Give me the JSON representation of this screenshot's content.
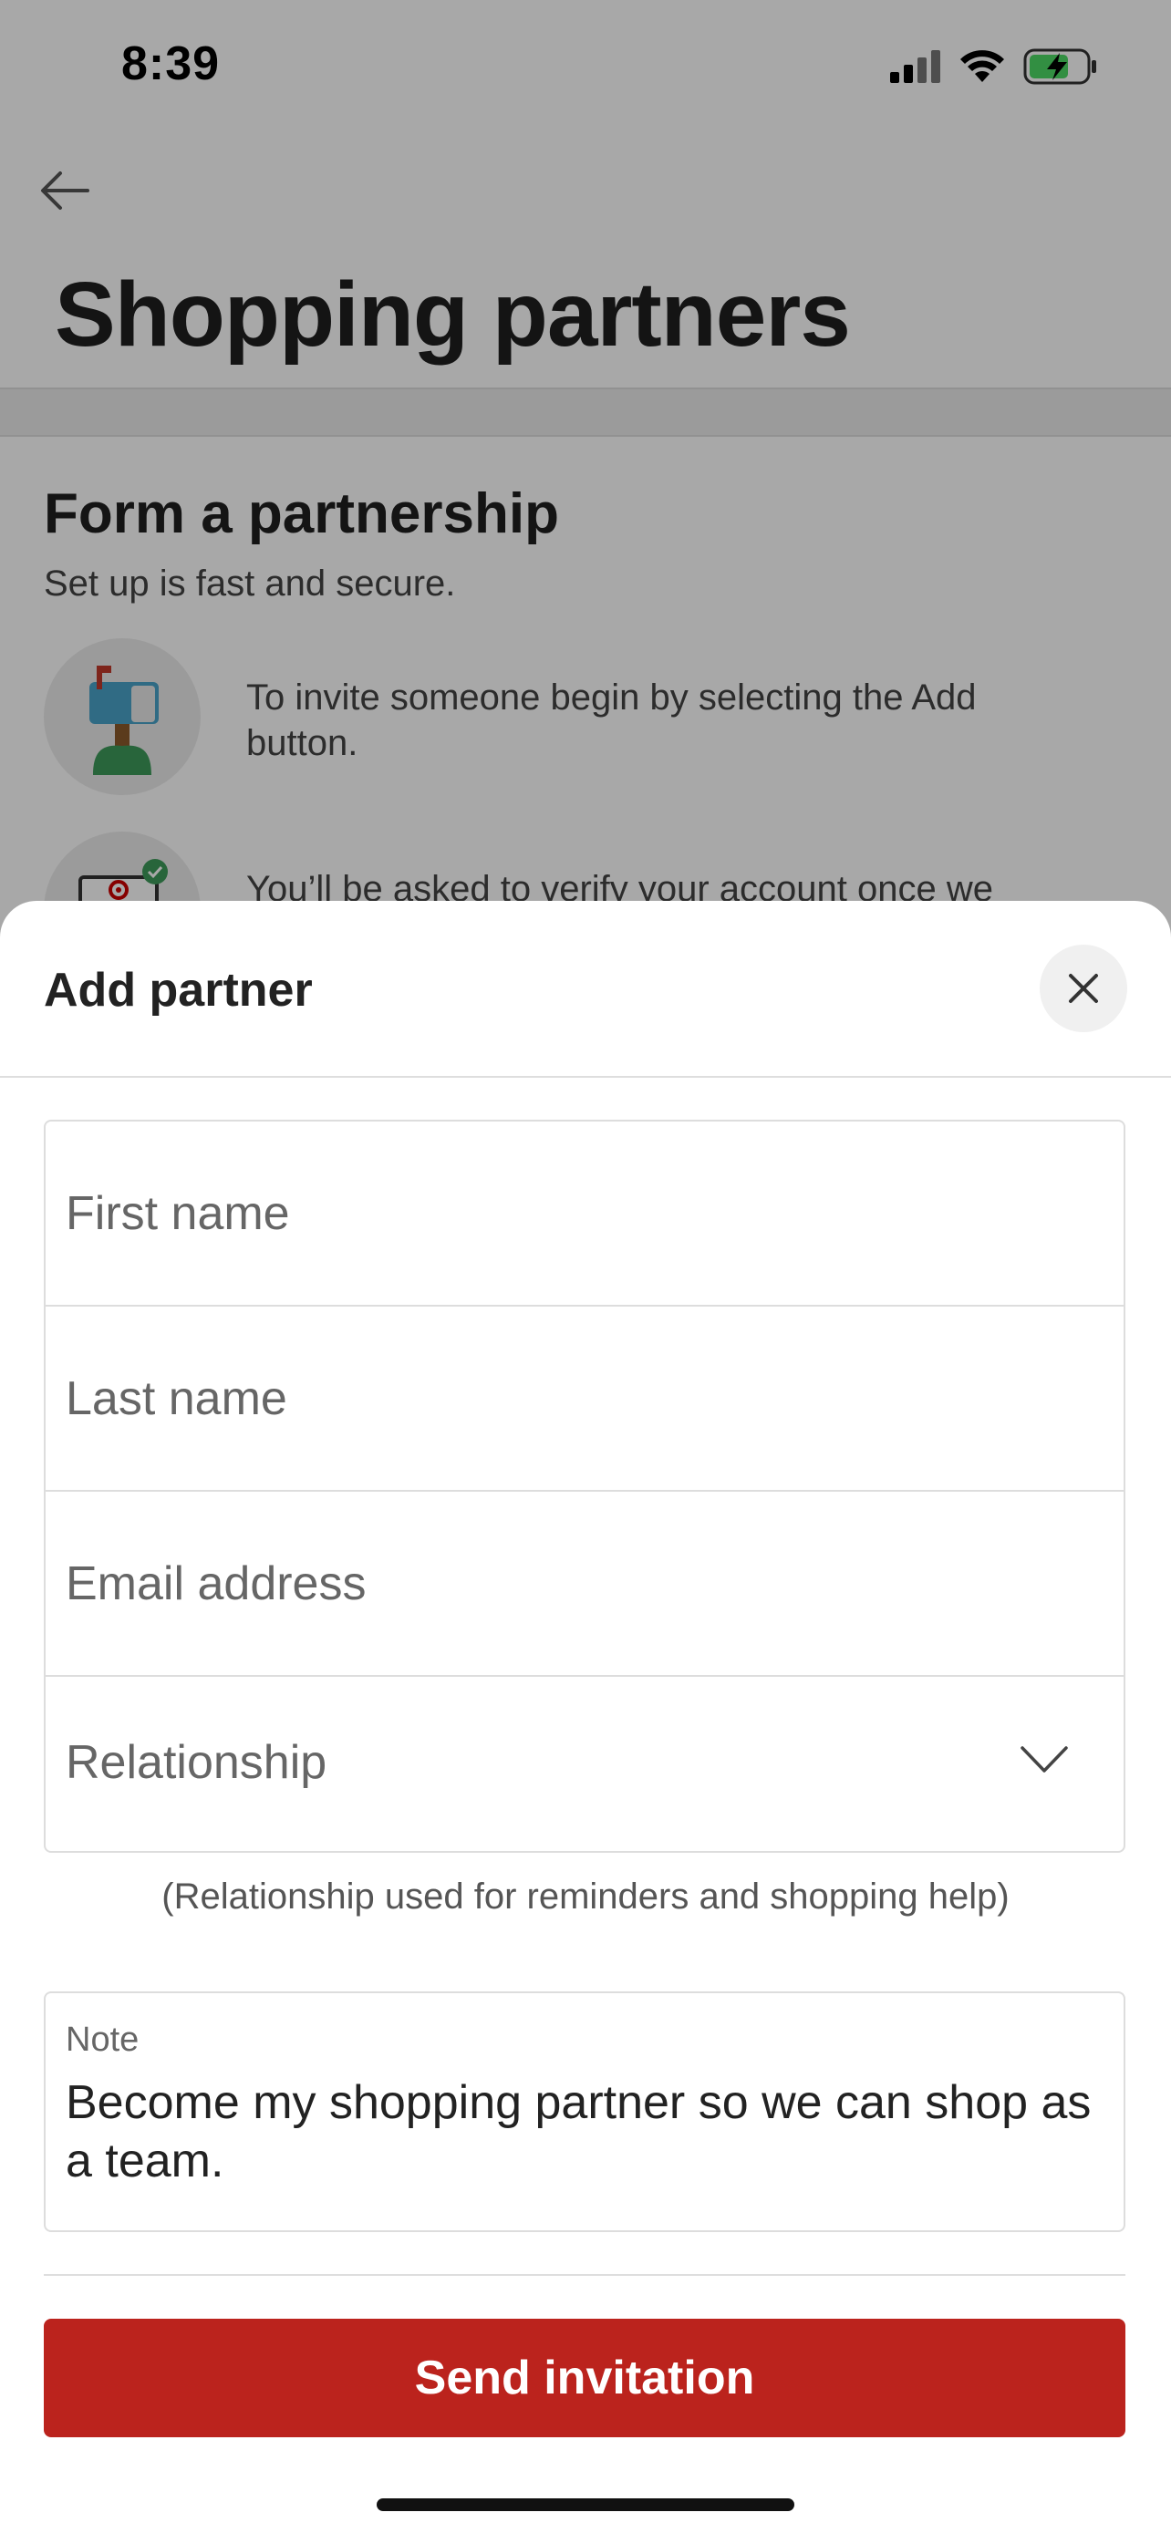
{
  "status_bar": {
    "time": "8:39",
    "icons": [
      "cellular-signal-icon",
      "wifi-icon",
      "battery-charging-icon"
    ],
    "battery_color": "#4cd964"
  },
  "background_page": {
    "back_icon": "arrow-left-icon",
    "title": "Shopping partners",
    "section_title": "Form a partnership",
    "section_subtitle": "Set up is fast and secure.",
    "steps": [
      {
        "icon": "mailbox-icon",
        "text": "To invite someone begin by selecting the Add button."
      },
      {
        "icon": "verified-account-icon",
        "text": "You’ll be asked to verify your account once we"
      }
    ]
  },
  "sheet": {
    "title": "Add partner",
    "close_icon": "close-icon",
    "fields": {
      "first_name_placeholder": "First name",
      "last_name_placeholder": "Last name",
      "email_placeholder": "Email address",
      "relationship_label": "Relationship"
    },
    "relationship_icon": "chevron-down-icon",
    "helper_text": "(Relationship used for reminders and shopping help)",
    "note": {
      "label": "Note",
      "value": "Become my shopping partner so we can shop as a team."
    },
    "submit_label": "Send invitation"
  },
  "colors": {
    "accent": "#bb231d",
    "scrim": "rgba(0,0,0,0.34)"
  }
}
